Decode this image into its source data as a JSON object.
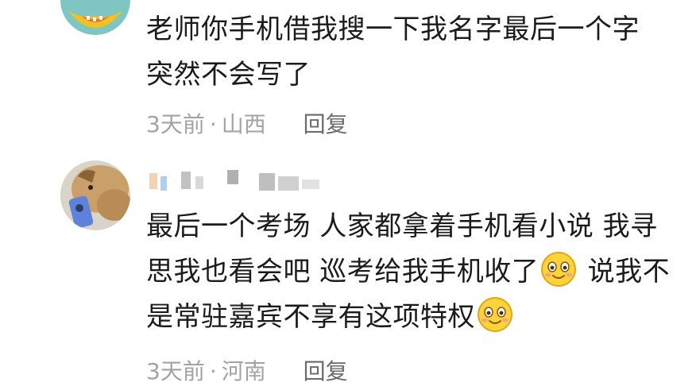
{
  "comments": [
    {
      "text_lines": [
        "老师你手机借我搜一下我名字最后一个字",
        "突然不会写了"
      ],
      "time": "3天前",
      "separator": "·",
      "location": "山西",
      "reply_label": "回复"
    },
    {
      "text_lines": [
        "最后一个考场 人家都拿着手机看小说 我寻",
        "思我也看会吧 巡考给我手机收了",
        " 说我不",
        "是常驻嘉宾不享有这项特权"
      ],
      "emojis": [
        "smiling-face-emoji",
        "smiling-face-emoji"
      ],
      "time": "3天前",
      "separator": "·",
      "location": "河南",
      "reply_label": "回复"
    }
  ]
}
